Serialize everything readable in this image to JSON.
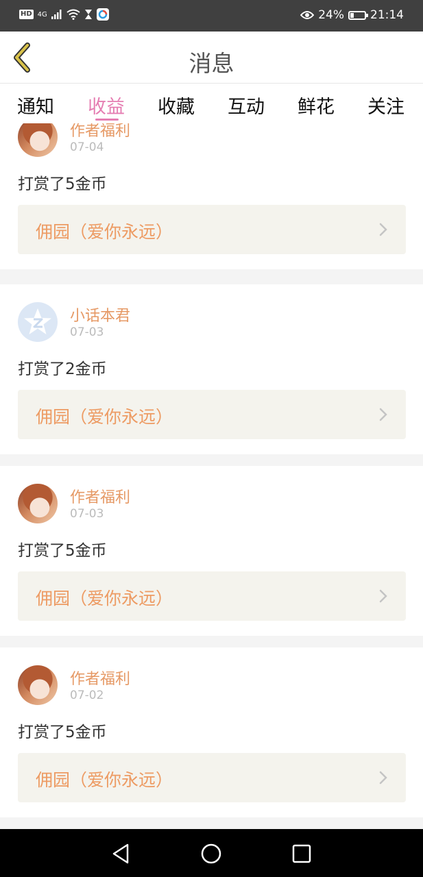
{
  "status_bar": {
    "hd": "HD",
    "signal": "4G",
    "battery": "24%",
    "battery_level": 0.24,
    "time": "21:14",
    "icons": [
      "wifi-icon",
      "hourglass-icon",
      "app-icon",
      "eye-icon",
      "battery-icon"
    ]
  },
  "header": {
    "title": "消息",
    "back_icon": "chevron-left-icon"
  },
  "tabs": {
    "items": [
      {
        "label": "通知"
      },
      {
        "label": "收益"
      },
      {
        "label": "收藏"
      },
      {
        "label": "互动"
      },
      {
        "label": "鲜花"
      },
      {
        "label": "关注"
      }
    ],
    "active_index": 1,
    "active_color": "#e57eb2"
  },
  "feed": {
    "items": [
      {
        "name": "作者福利",
        "date": "07-04",
        "message": "打赏了5金币",
        "book": "佣园（爱你永远）",
        "avatar": "anime-girl-avatar"
      },
      {
        "name": "小话本君",
        "date": "07-03",
        "message": "打赏了2金币",
        "book": "佣园（爱你永远）",
        "avatar": "qq-star-avatar"
      },
      {
        "name": "作者福利",
        "date": "07-03",
        "message": "打赏了5金币",
        "book": "佣园（爱你永远）",
        "avatar": "anime-girl-avatar"
      },
      {
        "name": "作者福利",
        "date": "07-02",
        "message": "打赏了5金币",
        "book": "佣园（爱你永远）",
        "avatar": "anime-girl-avatar"
      }
    ]
  },
  "navbar": {
    "icons": [
      "back-triangle-icon",
      "home-circle-icon",
      "recents-square-icon"
    ]
  },
  "colors": {
    "name": "#e69965",
    "book": "#ed9b63",
    "accent": "#e57eb2",
    "status_bar": "#404040"
  }
}
